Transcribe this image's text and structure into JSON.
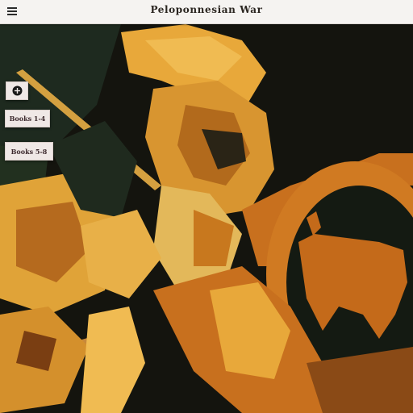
{
  "header": {
    "title": "Peloponnesian War",
    "menu_icon": "hamburger-menu-icon"
  },
  "sidebar": {
    "add_icon": "plus-circle-icon",
    "buttons": [
      {
        "label": "Books 1-4"
      },
      {
        "label": "Books 5-8"
      }
    ]
  },
  "artwork": {
    "subject": "hoplite-warrior-with-shield-illustration",
    "colors": {
      "background": "#14140e",
      "gold": "#e8a83a",
      "orange": "#c8701e",
      "dark_green": "#1f2a1e",
      "rust": "#8a4a16",
      "pale": "#e3b85a"
    }
  }
}
